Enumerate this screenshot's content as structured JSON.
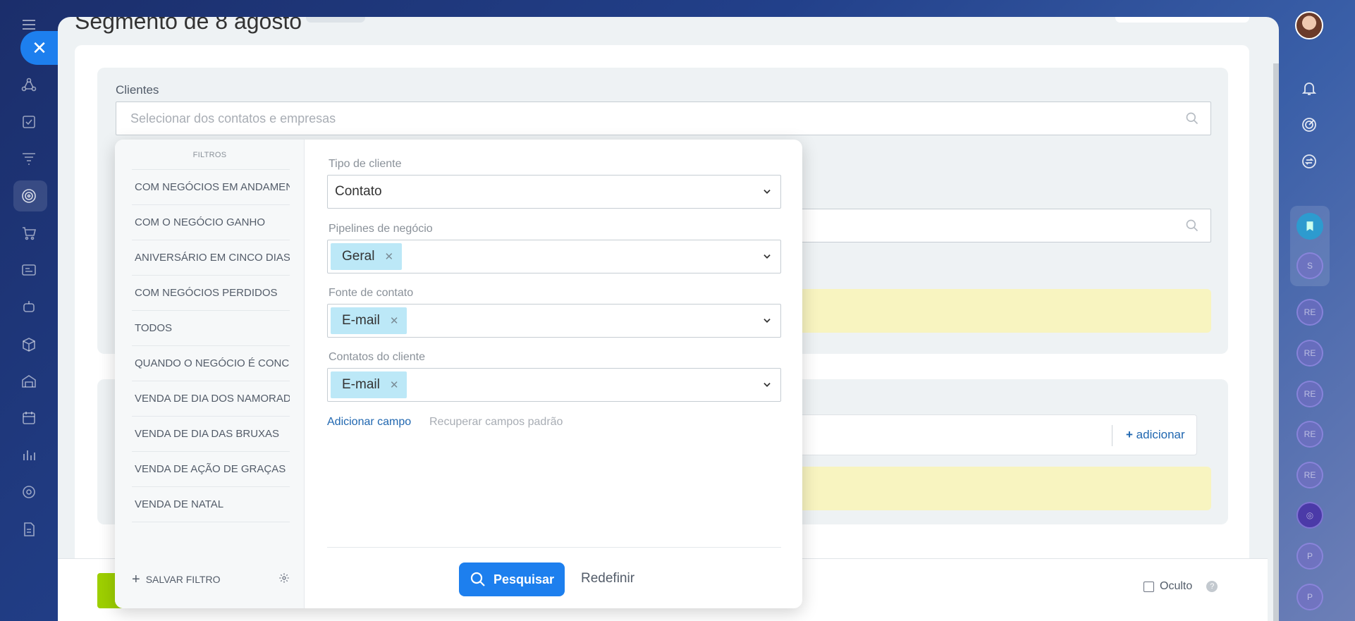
{
  "page": {
    "title": "Segmento de 8 agosto"
  },
  "nav": {
    "icons": [
      "menu-icon",
      "close-icon",
      "network-icon",
      "tasks-icon",
      "funnel-icon",
      "target-icon",
      "cart-icon",
      "card-icon",
      "robot-icon",
      "box-icon",
      "warehouse-icon",
      "calendar-icon",
      "chart-icon",
      "settings-icon",
      "document-icon"
    ]
  },
  "form": {
    "clientes_label": "Clientes",
    "clientes_placeholder": "Selecionar dos contatos e empresas",
    "adicionar": "adicionar",
    "oculto": "Oculto"
  },
  "filter": {
    "title": "FILTROS",
    "presets": [
      "COM NEGÓCIOS EM ANDAMENTO",
      "COM O NEGÓCIO GANHO",
      "ANIVERSÁRIO EM CINCO DIAS",
      "COM NEGÓCIOS PERDIDOS",
      "TODOS",
      "QUANDO O NEGÓCIO É CONCLUÍDO",
      "VENDA DE DIA DOS NAMORADOS",
      "VENDA DE DIA DAS BRUXAS",
      "VENDA DE AÇÃO DE GRAÇAS",
      "VENDA DE NATAL"
    ],
    "save_filter": "SALVAR FILTRO",
    "fields": {
      "client_type": {
        "label": "Tipo de cliente",
        "value": "Contato"
      },
      "pipelines": {
        "label": "Pipelines de negócio",
        "tag": "Geral"
      },
      "contact_source": {
        "label": "Fonte de contato",
        "tag": "E-mail"
      },
      "client_contacts": {
        "label": "Contatos do cliente",
        "tag": "E-mail"
      }
    },
    "add_field": "Adicionar campo",
    "reset_fields": "Recuperar campos padrão",
    "search_button": "Pesquisar",
    "reset_button": "Redefinir"
  },
  "rail": {
    "circles": [
      "S",
      "RE",
      "RE",
      "RE",
      "RE",
      "RE",
      "P",
      "P"
    ]
  },
  "colors": {
    "accent": "#1d7fee",
    "tag": "#bce8f7",
    "notice": "#f8f4c0",
    "green": "#9dcf00"
  }
}
